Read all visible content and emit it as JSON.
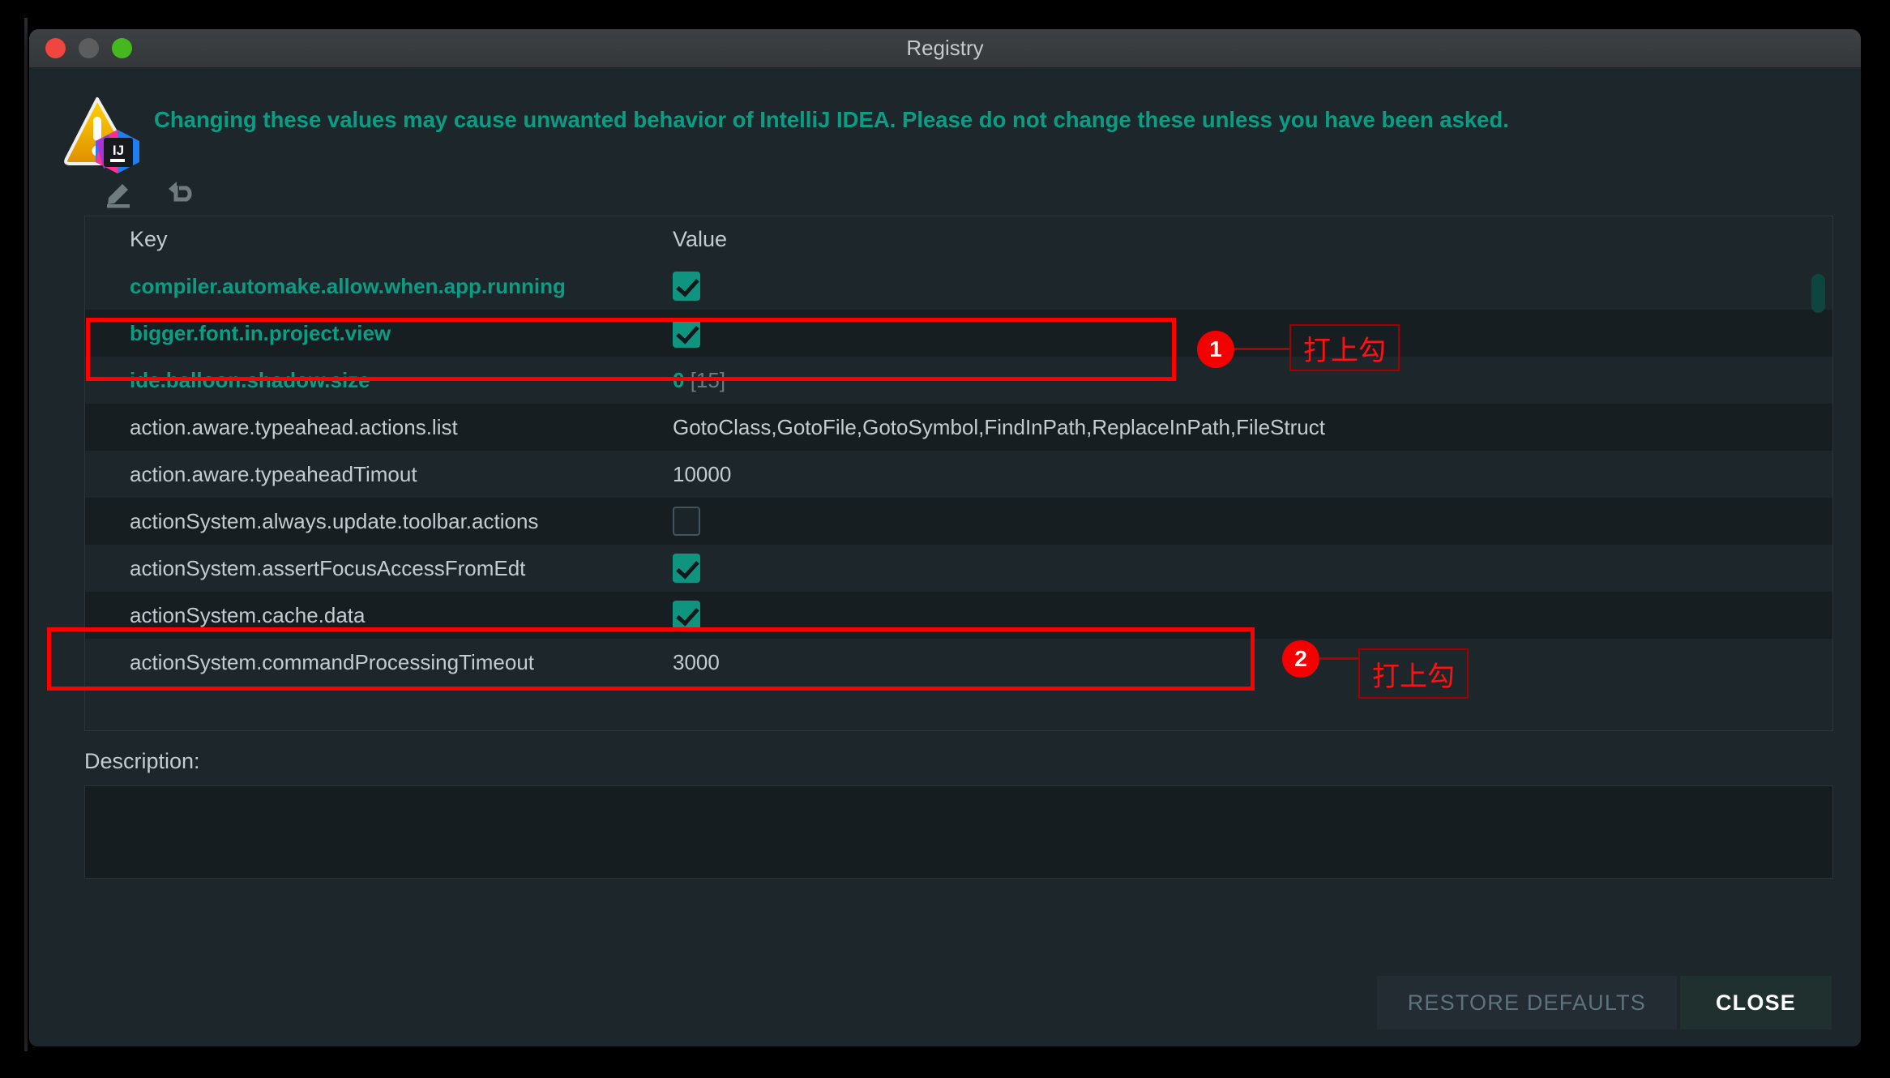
{
  "window": {
    "title": "Registry",
    "traffic_lights": [
      "close-red",
      "minimize-yellow",
      "maximize-green"
    ]
  },
  "warning": {
    "icon": "warning-triangle-with-intellij-badge",
    "text": "Changing these values may cause unwanted behavior of IntelliJ IDEA. Please do not change these unless you have been asked."
  },
  "toolbar": {
    "items": [
      {
        "name": "edit-icon",
        "tooltip": "Edit"
      },
      {
        "name": "revert-icon",
        "tooltip": "Revert"
      }
    ]
  },
  "table": {
    "columns": [
      "Key",
      "Value"
    ],
    "rows": [
      {
        "key": "compiler.automake.allow.when.app.running",
        "modified": true,
        "value_type": "checkbox",
        "checked": true,
        "value": ""
      },
      {
        "key": "bigger.font.in.project.view",
        "modified": true,
        "value_type": "checkbox",
        "checked": true,
        "value": ""
      },
      {
        "key": "ide.balloon.shadow.size",
        "modified": true,
        "value_type": "text",
        "value": "0",
        "default": "[15]"
      },
      {
        "key": "action.aware.typeahead.actions.list",
        "modified": false,
        "value_type": "text",
        "value": "GotoClass,GotoFile,GotoSymbol,FindInPath,ReplaceInPath,FileStruct"
      },
      {
        "key": "action.aware.typeaheadTimout",
        "modified": false,
        "value_type": "text",
        "value": "10000"
      },
      {
        "key": "actionSystem.always.update.toolbar.actions",
        "modified": false,
        "value_type": "checkbox",
        "checked": false,
        "value": ""
      },
      {
        "key": "actionSystem.assertFocusAccessFromEdt",
        "modified": false,
        "value_type": "checkbox",
        "checked": true,
        "value": ""
      },
      {
        "key": "actionSystem.cache.data",
        "modified": false,
        "value_type": "checkbox",
        "checked": true,
        "value": ""
      },
      {
        "key": "actionSystem.commandProcessingTimeout",
        "modified": false,
        "value_type": "text",
        "value": "3000"
      }
    ]
  },
  "description": {
    "label": "Description:",
    "content": ""
  },
  "footer": {
    "restore_defaults_label": "RESTORE DEFAULTS",
    "close_label": "CLOSE"
  },
  "annotations": [
    {
      "badge": "1",
      "label": "打上勾"
    },
    {
      "badge": "2",
      "label": "打上勾"
    }
  ],
  "colors": {
    "accent_teal": "#0b9d84",
    "checkbox_on": "#0f9480",
    "annotation_red": "#ff0000",
    "window_bg": "#1d262b",
    "row_alt_bg": "#161e22",
    "text_primary": "#c3ccd1",
    "text_dim": "#6d7a80"
  }
}
